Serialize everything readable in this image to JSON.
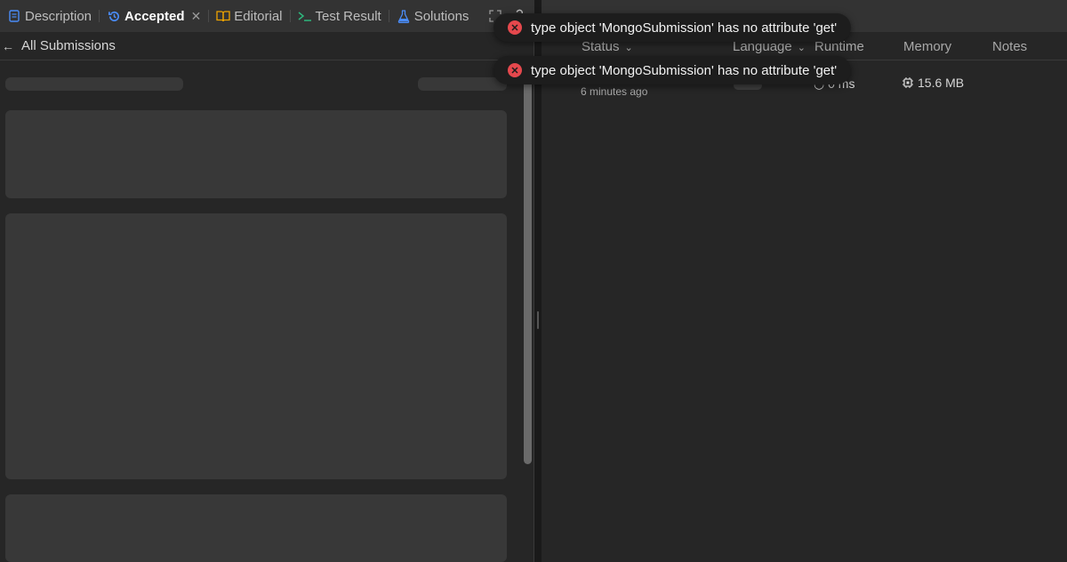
{
  "left_tabs": [
    {
      "label": "Description",
      "icon": "description-icon",
      "color": "#4a8cf7"
    },
    {
      "label": "Accepted",
      "icon": "history-icon",
      "color": "#4a8cf7",
      "active": true
    },
    {
      "label": "Editorial",
      "icon": "book-icon",
      "color": "#f0a500"
    },
    {
      "label": "Test Result",
      "icon": "terminal-icon",
      "color": "#2eb67d"
    },
    {
      "label": "Solutions",
      "icon": "flask-icon",
      "color": "#4a8cf7"
    }
  ],
  "subheader": {
    "back_label": "All Submissions"
  },
  "table": {
    "headers": {
      "status": "Status",
      "language": "Language",
      "runtime": "Runtime",
      "memory": "Memory",
      "notes": "Notes"
    },
    "row": {
      "time": "6 minutes ago",
      "runtime": "0 ms",
      "memory": "15.6 MB"
    }
  },
  "toasts": [
    {
      "message": "type object 'MongoSubmission' has no attribute 'get'"
    },
    {
      "message": "type object 'MongoSubmission' has no attribute 'get'"
    }
  ],
  "colors": {
    "error": "#e5484d",
    "accent": "#4a8cf7"
  }
}
